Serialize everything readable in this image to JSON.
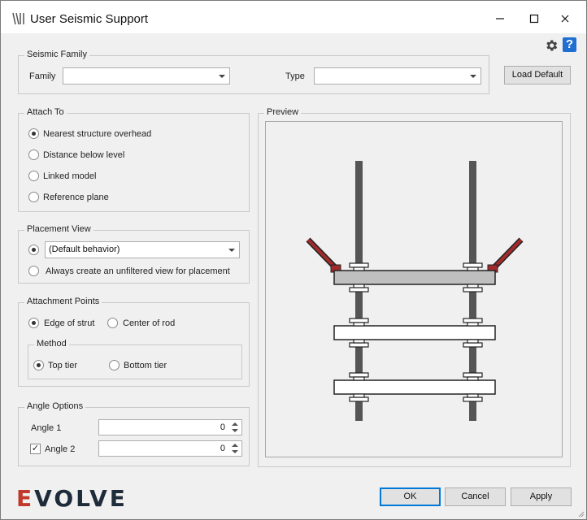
{
  "window": {
    "title": "User Seismic Support",
    "controls": {
      "minimize": "–",
      "maximize": "☐",
      "close": "✕"
    }
  },
  "toolbar": {
    "help_glyph": "?",
    "icons": [
      "gear-icon",
      "help-icon"
    ]
  },
  "seismic_family": {
    "legend": "Seismic Family",
    "family_label": "Family",
    "family_value": "",
    "type_label": "Type",
    "type_value": ""
  },
  "load_default_label": "Load Default",
  "attach_to": {
    "legend": "Attach To",
    "options": [
      "Nearest structure overhead",
      "Distance below level",
      "Linked model",
      "Reference plane"
    ],
    "selected": 0
  },
  "placement_view": {
    "legend": "Placement View",
    "combo_value": "(Default behavior)",
    "option_unfiltered": "Always create an unfiltered view for placement",
    "selected": 0
  },
  "attachment_points": {
    "legend": "Attachment Points",
    "edge_label": "Edge of strut",
    "center_label": "Center of rod",
    "selected": "edge",
    "method": {
      "legend": "Method",
      "top_label": "Top tier",
      "bottom_label": "Bottom tier",
      "selected": "top"
    }
  },
  "angle_options": {
    "legend": "Angle Options",
    "angle1_label": "Angle 1",
    "angle1_value": "0",
    "angle2_label": "Angle 2",
    "angle2_value": "0",
    "angle2_checked": true,
    "check_glyph": "✓"
  },
  "preview": {
    "legend": "Preview"
  },
  "footer": {
    "logo_first": "E",
    "logo_rest": "VOLVE",
    "ok_label": "OK",
    "cancel_label": "Cancel",
    "apply_label": "Apply"
  },
  "colors": {
    "strut_top_fill": "#bfbfbf",
    "rod": "#555555",
    "brace": "#a32a2a",
    "accent": "#0078d7",
    "help": "#1f6fd1"
  }
}
